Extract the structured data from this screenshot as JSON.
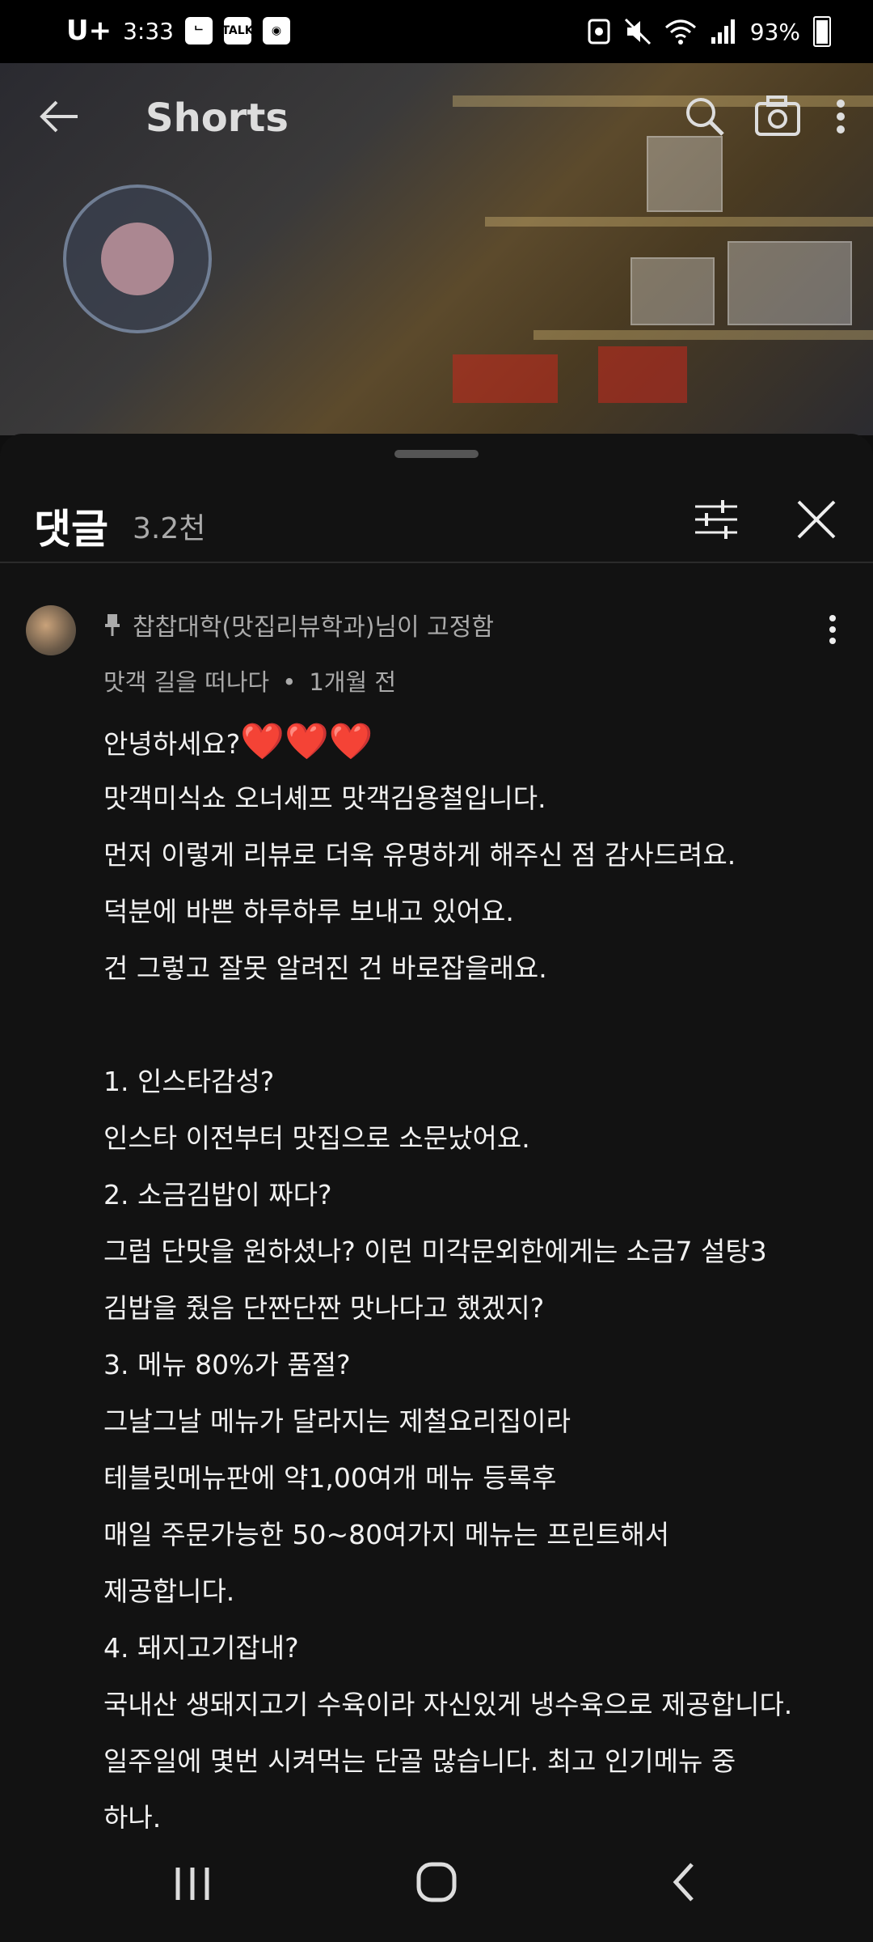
{
  "status_bar": {
    "carrier": "U+",
    "time": "3:33",
    "apps": [
      "ᄂ",
      "TALK",
      "◉"
    ],
    "battery": "93%"
  },
  "header": {
    "title": "Shorts"
  },
  "comments_panel": {
    "title": "댓글",
    "count": "3.2천",
    "pinned_comment": {
      "pinned_label": "찹찹대학(맛집리뷰학과)님이 고정함",
      "author": "맛객 길을 떠나다",
      "time": "1개월 전",
      "lines": [
        "안녕하세요?",
        "맛객미식쇼 오너셰프 맛객김용철입니다.",
        "먼저 이렇게 리뷰로 더욱 유명하게 해주신 점 감사드려요.",
        "덕분에 바쁜 하루하루 보내고 있어요.",
        "건 그렇고 잘못 알려진 건 바로잡을래요.",
        "",
        "1. 인스타감성?",
        "인스타 이전부터 맛집으로 소문났어요.",
        "2. 소금김밥이 짜다?",
        "그럼 단맛을 원하셨나?  이런 미각문외한에게는 소금7 설탕3",
        "김밥을 줬음 단짠단짠 맛나다고 했겠지?",
        "3. 메뉴 80%가 품절?",
        "그날그날 메뉴가 달라지는 제철요리집이라",
        "테블릿메뉴판에 약1,00여개 메뉴 등록후",
        "매일 주문가능한 50~80여가지 메뉴는 프린트해서",
        "제공합니다.",
        "4. 돼지고기잡내?",
        "국내산 생돼지고기 수육이라 자신있게 냉수육으로 제공합니다.",
        "일주일에 몇번 시켜먹는 단골 많습니다. 최고 인기메뉴 중",
        "하나."
      ],
      "hearts": "❤️❤️❤️"
    }
  }
}
